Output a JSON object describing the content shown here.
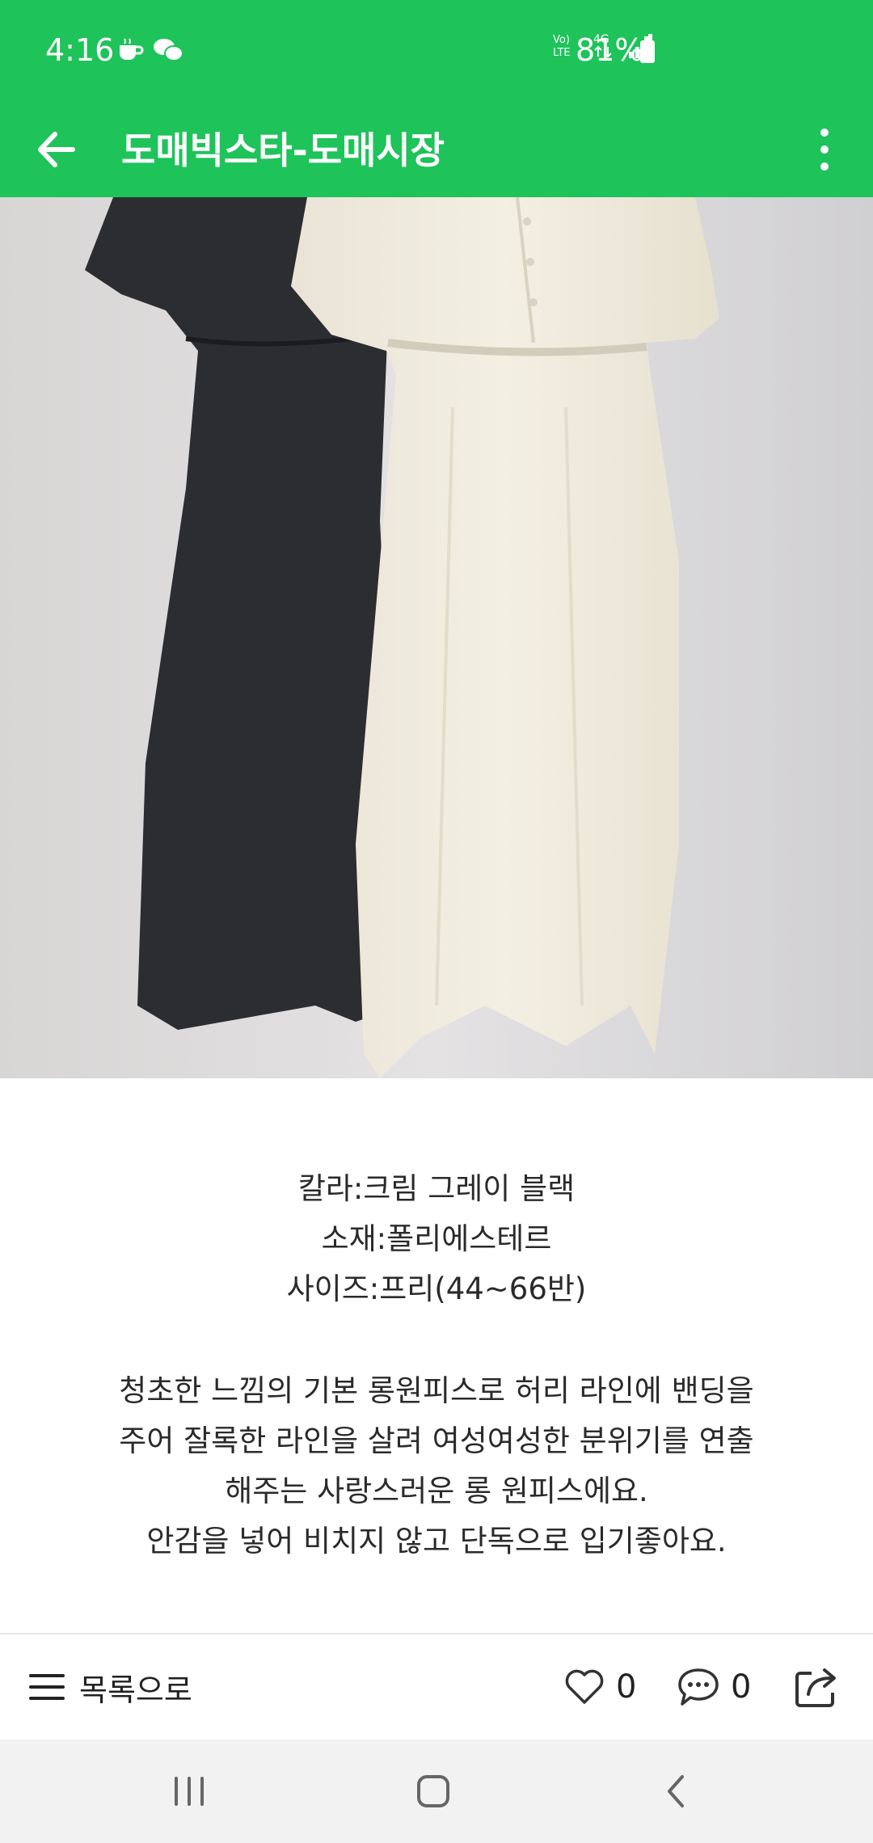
{
  "status_bar": {
    "time": "4:16",
    "network": "4G",
    "volte": "Vo) LTE",
    "battery": "81%",
    "icons": [
      "coffee-icon",
      "chat-icon",
      "volte-icon",
      "4g-icon",
      "signal-icon",
      "battery-icon"
    ]
  },
  "app_bar": {
    "title": "도매빅스타-도매시장",
    "icons": [
      "back-arrow-icon",
      "more-vert-icon"
    ]
  },
  "product": {
    "image": "product-photo",
    "specs": [
      "칼라:크림 그레이 블랙",
      "소재:폴리에스테르",
      "사이즈:프리(44~66반)"
    ],
    "description": [
      "청초한 느낌의 기본 롱원피스로 허리 라인에 밴딩을",
      "주어 잘록한 라인을 살려 여성여성한 분위기를 연출",
      "해주는 사랑스러운 롱 원피스에요.",
      "안감을 넣어 비치지 않고 단독으로 입기좋아요."
    ]
  },
  "bottom_bar": {
    "list_label": "목록으로",
    "like_count": "0",
    "comment_count": "0",
    "icons": [
      "menu-icon",
      "heart-icon",
      "comment-icon",
      "share-icon"
    ]
  },
  "nav_bar": {
    "icons": [
      "recents-icon",
      "home-icon",
      "back-icon"
    ]
  },
  "colors": {
    "brand_green": "#1ec35a",
    "nav_background": "#f2f2f2"
  }
}
